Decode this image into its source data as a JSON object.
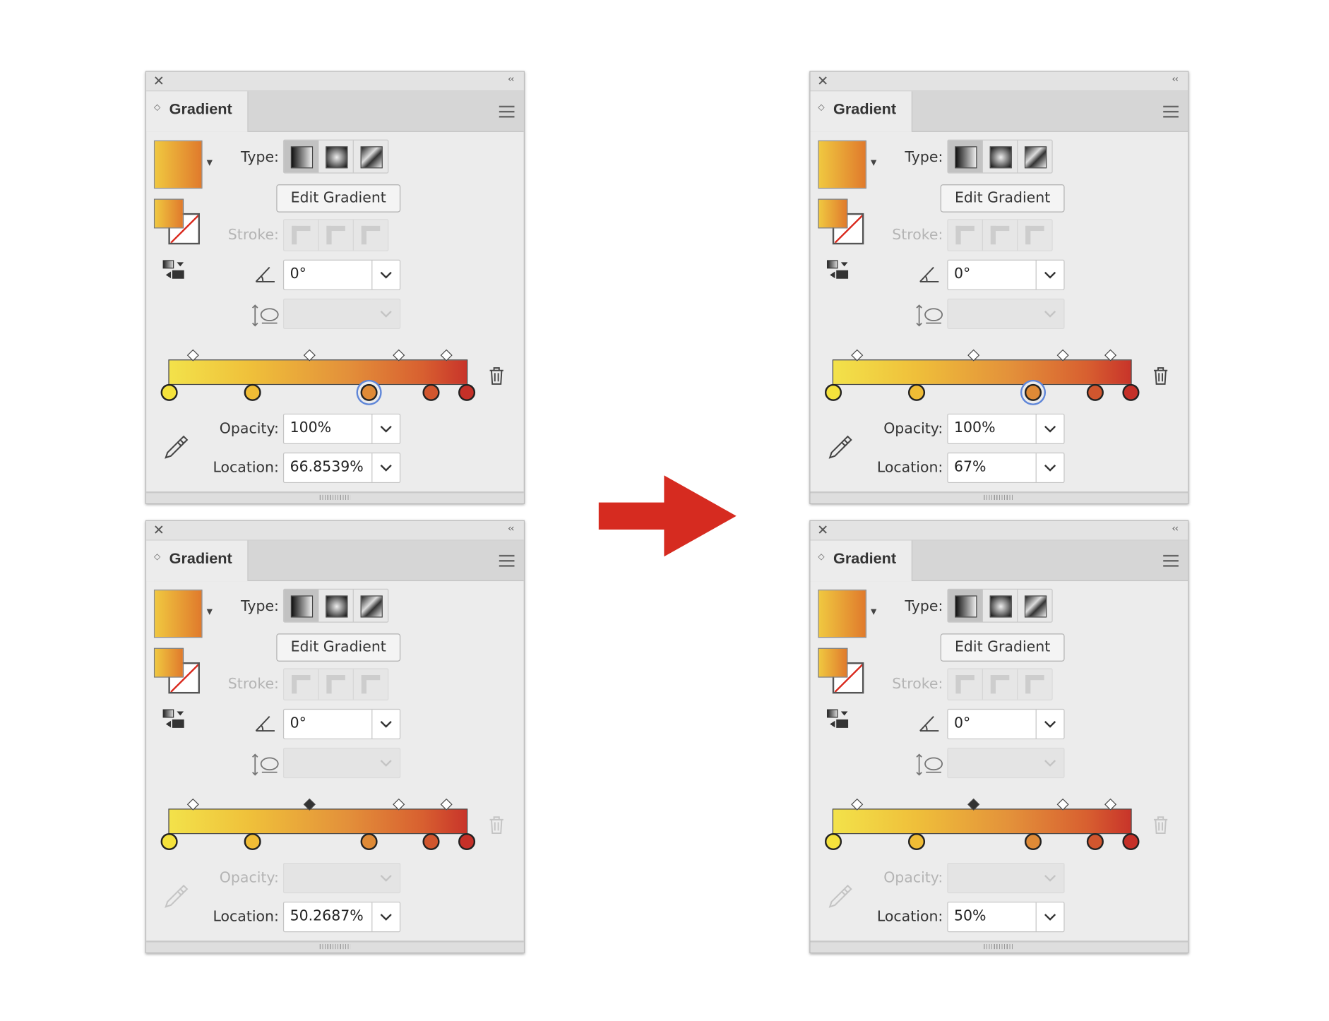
{
  "panels": [
    {
      "title": "Gradient",
      "type_label": "Type:",
      "edit_button": "Edit Gradient",
      "stroke_label": "Stroke:",
      "angle": "0°",
      "opacity_label": "Opacity:",
      "opacity": "100%",
      "location_label": "Location:",
      "location": "66.8539%",
      "selected_stop": 3,
      "selected_midpoint": null,
      "opacity_enabled": true
    },
    {
      "title": "Gradient",
      "type_label": "Type:",
      "edit_button": "Edit Gradient",
      "stroke_label": "Stroke:",
      "angle": "0°",
      "opacity_label": "Opacity:",
      "opacity": "",
      "location_label": "Location:",
      "location": "50.2687%",
      "selected_stop": null,
      "selected_midpoint": 2,
      "opacity_enabled": false
    },
    {
      "title": "Gradient",
      "type_label": "Type:",
      "edit_button": "Edit Gradient",
      "stroke_label": "Stroke:",
      "angle": "0°",
      "opacity_label": "Opacity:",
      "opacity": "100%",
      "location_label": "Location:",
      "location": "67%",
      "selected_stop": 3,
      "selected_midpoint": null,
      "opacity_enabled": true
    },
    {
      "title": "Gradient",
      "type_label": "Type:",
      "edit_button": "Edit Gradient",
      "stroke_label": "Stroke:",
      "angle": "0°",
      "opacity_label": "Opacity:",
      "opacity": "",
      "location_label": "Location:",
      "location": "50%",
      "selected_stop": null,
      "selected_midpoint": 2,
      "opacity_enabled": false
    }
  ],
  "gradient_stops": [
    {
      "color": "#f5e23c",
      "location_percent": 0
    },
    {
      "color": "#f0bc35",
      "location_percent": 28
    },
    {
      "color": "#df8a36",
      "location_percent": 67
    },
    {
      "color": "#d1562e",
      "location_percent": 88
    },
    {
      "color": "#c53028",
      "location_percent": 100
    }
  ],
  "midpoints_percent": [
    8,
    47,
    77,
    93
  ],
  "colors": {
    "arrow": "#d62b20",
    "selection_ring": "#5f86d8",
    "panel_bg": "#ececec"
  },
  "icons": {
    "close": "close-icon",
    "collapse": "double-chevron-left-icon",
    "menu": "hamburger-menu-icon",
    "angle": "angle-icon",
    "aspect": "aspect-ratio-icon",
    "trash": "trash-icon",
    "eyedropper": "eyedropper-icon"
  }
}
